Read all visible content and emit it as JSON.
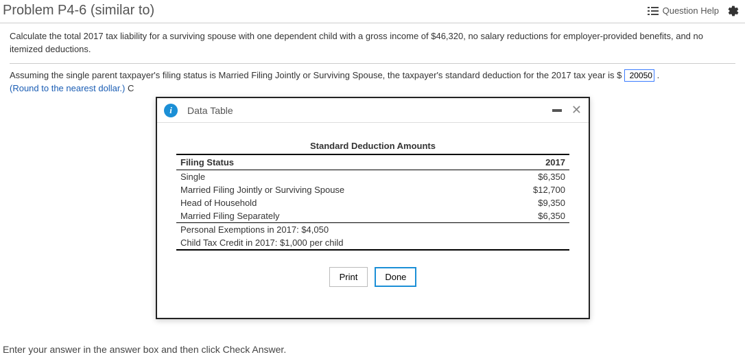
{
  "header": {
    "title": "Problem P4-6 (similar to)",
    "help_label": "Question Help"
  },
  "problem": {
    "para1": "Calculate the total 2017 tax liability for a surviving spouse with one dependent child with a gross income of $46,320, no salary reductions for employer-provided benefits, and no itemized deductions.",
    "para2_prefix": "Assuming the single parent taxpayer's filing status is Married Filing Jointly or Surviving Spouse, the taxpayer's standard deduction for the 2017 tax year is $",
    "input_value": "20050",
    "para2_suffix": ".",
    "round_note": "(Round to the nearest dollar.)",
    "trailing_char": "C"
  },
  "modal": {
    "title": "Data Table",
    "table_title": "Standard Deduction Amounts",
    "col1": "Filing Status",
    "col2": "2017",
    "rows": [
      {
        "label": "Single",
        "value": "$6,350"
      },
      {
        "label": "Married Filing Jointly or Surviving Spouse",
        "value": "$12,700"
      },
      {
        "label": "Head of Household",
        "value": "$9,350"
      },
      {
        "label": "Married Filing Separately",
        "value": "$6,350"
      }
    ],
    "note1": "Personal Exemptions in 2017: $4,050",
    "note2": "Child Tax Credit in 2017: $1,000 per child",
    "print_label": "Print",
    "done_label": "Done"
  },
  "footer": {
    "instruction": "Enter your answer in the answer box and then click Check Answer."
  }
}
